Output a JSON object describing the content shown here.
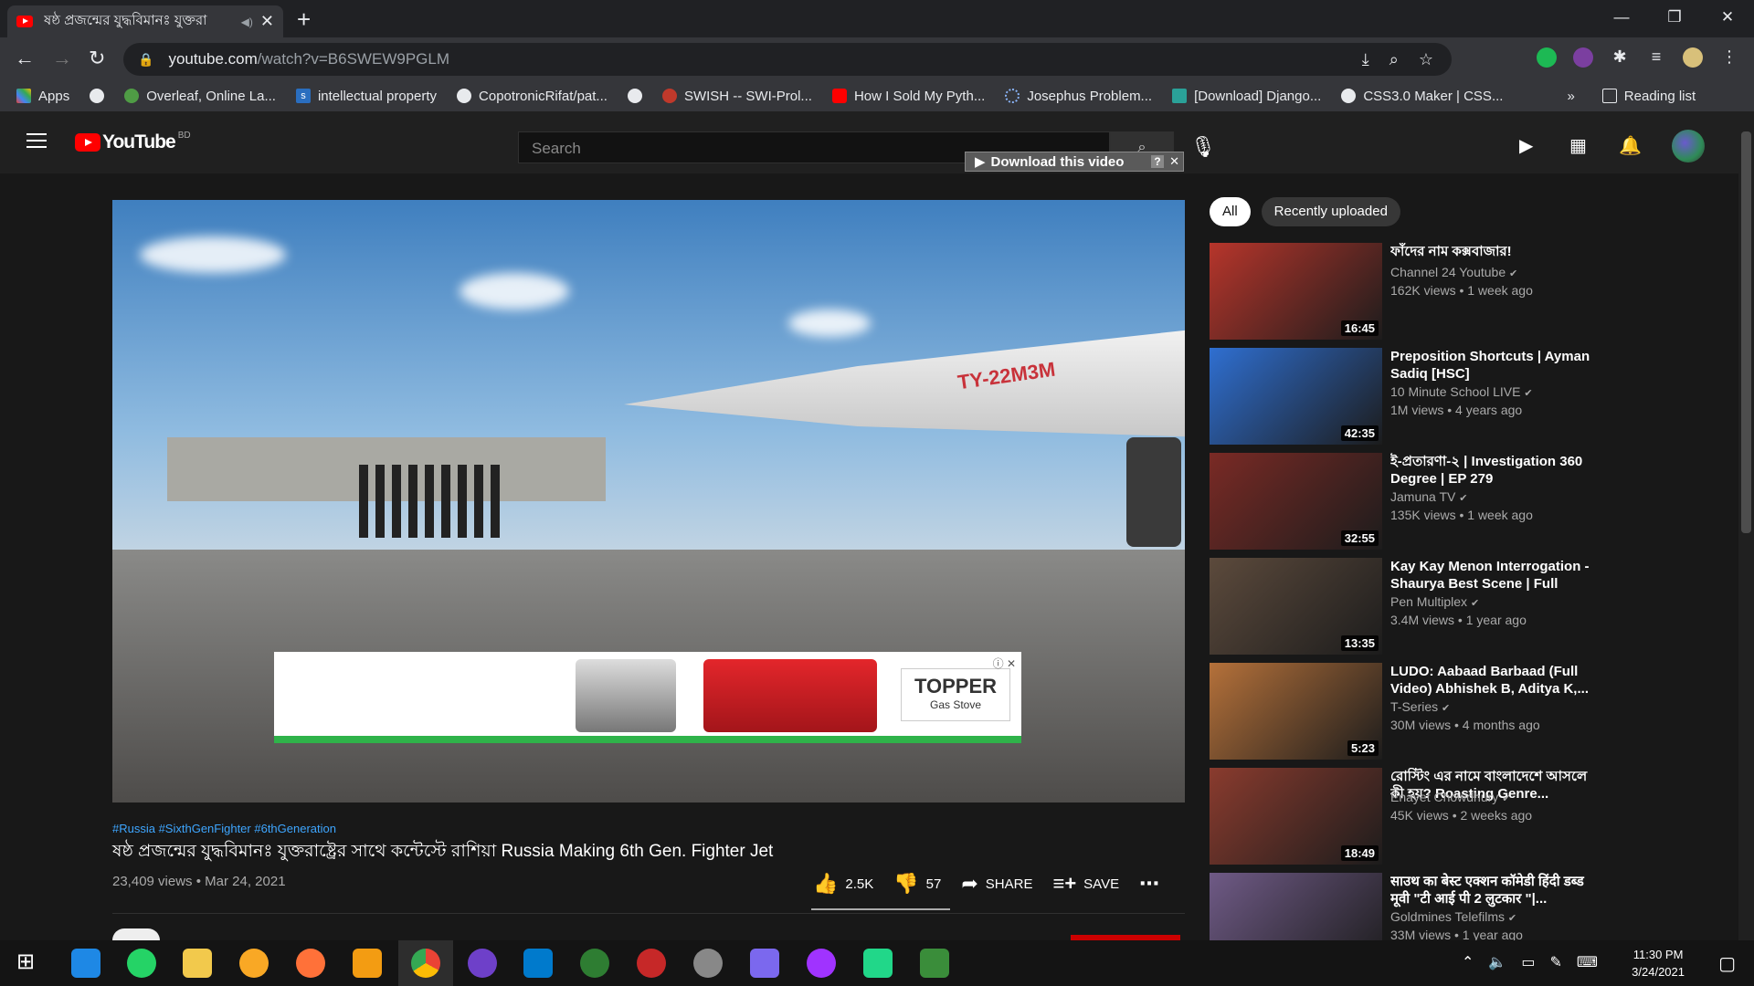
{
  "browser": {
    "tab_title": "ষষ্ঠ প্রজন্মের যুদ্ধবিমানঃ যুক্তরা",
    "url_host": "youtube.com",
    "url_path": "/watch?v=B6SWEW9PGLM",
    "bookmarks": [
      "Apps",
      "Overleaf, Online La...",
      "intellectual property",
      "CopotronicRifat/pat...",
      "SWISH -- SWI-Prol...",
      "How I Sold My Pyth...",
      "Josephus Problem...",
      "[Download] Django...",
      "CSS3.0 Maker | CSS..."
    ],
    "reading_list": "Reading list",
    "more": "»"
  },
  "youtube": {
    "logo_text": "YouTube",
    "region": "BD",
    "search_placeholder": "Search",
    "download_bar": "Download this video",
    "video": {
      "hashtags": "#Russia #SixthGenFighter #6thGeneration",
      "title": "ষষ্ঠ প্রজন্মের যুদ্ধবিমানঃ যুক্তরাষ্ট্রের সাথে কন্টেস্টে রাশিয়া Russia Making 6th Gen. Fighter Jet",
      "views": "23,409 views",
      "date": "Mar 24, 2021",
      "likes": "2.5K",
      "dislikes": "57",
      "share": "SHARE",
      "save": "SAVE",
      "plane_label": "TY-22M3M",
      "ad_brand": "TOPPER",
      "ad_sub": "Gas Stove"
    },
    "chips": [
      "All",
      "Recently uploaded"
    ],
    "recommendations": [
      {
        "title": "ফাঁদের নাম কক্সবাজার!",
        "channel": "Channel 24 Youtube",
        "meta": "162K views • 1 week ago",
        "duration": "16:45",
        "color": "#b7352b"
      },
      {
        "title": "Preposition Shortcuts | Ayman Sadiq [HSC]",
        "channel": "10 Minute School LIVE",
        "meta": "1M views • 4 years ago",
        "duration": "42:35",
        "color": "#2f6fd1"
      },
      {
        "title": "ই-প্রতারণা-২ | Investigation 360 Degree | EP 279",
        "channel": "Jamuna TV",
        "meta": "135K views • 1 week ago",
        "duration": "32:55",
        "color": "#7a2a25"
      },
      {
        "title": "Kay Kay Menon Interrogation - Shaurya Best Scene | Full Hind...",
        "channel": "Pen Multiplex",
        "meta": "3.4M views • 1 year ago",
        "duration": "13:35",
        "color": "#5c4a3c"
      },
      {
        "title": "LUDO: Aabaad Barbaad (Full Video) Abhishek B, Aditya K,...",
        "channel": "T-Series",
        "meta": "30M views • 4 months ago",
        "duration": "5:23",
        "color": "#b5713a"
      },
      {
        "title": "রোস্টিং এর নামে বাংলাদেশে আসলে কী হয়? Roasting Genre...",
        "channel": "Enayet Chowdhury",
        "meta": "45K views • 2 weeks ago",
        "duration": "18:49",
        "color": "#8a3b2e"
      },
      {
        "title": "साउथ का बेस्ट एक्शन कॉमेडी हिंदी डब्ड मूवी \"टी आई पी 2 लुटकार \"|...",
        "channel": "Goldmines Telefilms",
        "meta": "33M views • 1 year ago",
        "duration": "",
        "color": "#6f5a86"
      }
    ]
  },
  "taskbar": {
    "time": "11:30 PM",
    "date": "3/24/2021"
  }
}
